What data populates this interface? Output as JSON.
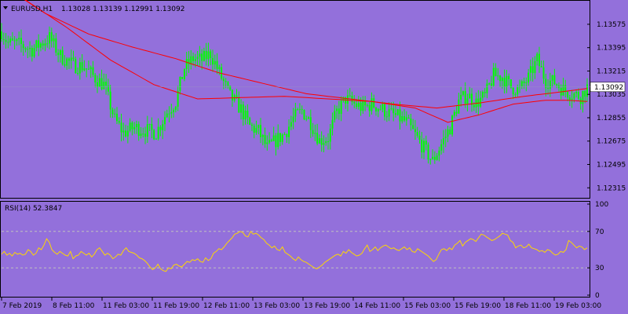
{
  "header": {
    "menu_arrow": "triangle-down-icon",
    "symbol": "EURUSD,H1",
    "ohlc": "1.13028 1.13139 1.12991 1.13092"
  },
  "rsi_header": "RSI(14) 52.3847",
  "colors": {
    "background": "#9370DB",
    "bull_candle": "#00FF00",
    "bear_candle": "#00FF00",
    "ma": "#FF0000",
    "rsi": "#FFD700",
    "rsi_levels": "#C0C0C0",
    "axis": "#000000"
  },
  "chart_data": [
    {
      "type": "candlestick",
      "title": "EURUSD,H1",
      "ylim": [
        1.1225,
        1.1375
      ],
      "y_ticks": [
        "1.13575",
        "1.13395",
        "1.13215",
        "1.13035",
        "1.12855",
        "1.12675",
        "1.12495",
        "1.12315"
      ],
      "current_price": "1.13092",
      "x_ticks": [
        "7 Feb 2019",
        "8 Feb 11:00",
        "11 Feb 03:00",
        "11 Feb 19:00",
        "12 Feb 11:00",
        "13 Feb 03:00",
        "13 Feb 19:00",
        "14 Feb 11:00",
        "15 Feb 03:00",
        "15 Feb 19:00",
        "18 Feb 11:00",
        "19 Feb 03:00"
      ],
      "close_path": [
        [
          0,
          1.1352
        ],
        [
          3,
          1.1343
        ],
        [
          8,
          1.1342
        ],
        [
          14,
          1.1338
        ],
        [
          22,
          1.1347
        ],
        [
          27,
          1.1333
        ],
        [
          33,
          1.1326
        ],
        [
          38,
          1.1325
        ],
        [
          43,
          1.1316
        ],
        [
          47,
          1.1311
        ],
        [
          52,
          1.1284
        ],
        [
          56,
          1.1274
        ],
        [
          61,
          1.1278
        ],
        [
          66,
          1.1276
        ],
        [
          71,
          1.1274
        ],
        [
          76,
          1.129
        ],
        [
          80,
          1.1298
        ],
        [
          84,
          1.1324
        ],
        [
          88,
          1.1331
        ],
        [
          92,
          1.133
        ],
        [
          96,
          1.1335
        ],
        [
          100,
          1.132
        ],
        [
          105,
          1.1302
        ],
        [
          110,
          1.1292
        ],
        [
          114,
          1.1279
        ],
        [
          118,
          1.1275
        ],
        [
          122,
          1.1262
        ],
        [
          126,
          1.1268
        ],
        [
          130,
          1.1273
        ],
        [
          134,
          1.1285
        ],
        [
          138,
          1.1291
        ],
        [
          142,
          1.1282
        ],
        [
          146,
          1.1268
        ],
        [
          150,
          1.127
        ],
        [
          154,
          1.129
        ],
        [
          158,
          1.13
        ],
        [
          162,
          1.1296
        ],
        [
          166,
          1.1293
        ],
        [
          170,
          1.1296
        ],
        [
          174,
          1.1293
        ],
        [
          178,
          1.1289
        ],
        [
          182,
          1.1286
        ],
        [
          186,
          1.1282
        ],
        [
          190,
          1.1272
        ],
        [
          194,
          1.1262
        ],
        [
          198,
          1.1252
        ],
        [
          202,
          1.1265
        ],
        [
          206,
          1.1278
        ],
        [
          210,
          1.1298
        ],
        [
          214,
          1.1303
        ],
        [
          218,
          1.1297
        ],
        [
          222,
          1.1302
        ],
        [
          226,
          1.1318
        ],
        [
          230,
          1.1317
        ],
        [
          234,
          1.1309
        ],
        [
          238,
          1.1307
        ],
        [
          242,
          1.1316
        ],
        [
          246,
          1.133
        ],
        [
          250,
          1.1314
        ],
        [
          254,
          1.1313
        ],
        [
          258,
          1.1307
        ],
        [
          262,
          1.1304
        ],
        [
          266,
          1.1302
        ],
        [
          269,
          1.1309
        ]
      ],
      "series": [
        {
          "name": "",
          "color": "#FF0000",
          "points": [
            [
              0,
              1.1388
            ],
            [
              20,
              1.1366
            ],
            [
              40,
              1.135
            ],
            [
              60,
              1.134
            ],
            [
              80,
              1.1331
            ],
            [
              100,
              1.132
            ],
            [
              120,
              1.1312
            ],
            [
              140,
              1.1304
            ],
            [
              160,
              1.13
            ],
            [
              180,
              1.1296
            ],
            [
              200,
              1.1293
            ],
            [
              220,
              1.1297
            ],
            [
              240,
              1.1302
            ],
            [
              255,
              1.1305
            ],
            [
              269,
              1.1308
            ]
          ]
        },
        {
          "name": "",
          "color": "#FF0000",
          "points": [
            [
              0,
              1.1395
            ],
            [
              12,
              1.1375
            ],
            [
              30,
              1.1355
            ],
            [
              50,
              1.133
            ],
            [
              70,
              1.1311
            ],
            [
              90,
              1.13
            ],
            [
              110,
              1.1301
            ],
            [
              130,
              1.1302
            ],
            [
              150,
              1.13
            ],
            [
              170,
              1.1298
            ],
            [
              190,
              1.1293
            ],
            [
              205,
              1.1282
            ],
            [
              220,
              1.1288
            ],
            [
              235,
              1.1296
            ],
            [
              250,
              1.1299
            ],
            [
              260,
              1.1299
            ],
            [
              269,
              1.1298
            ]
          ]
        }
      ]
    },
    {
      "type": "line",
      "title": "RSI(14) 52.3847",
      "ylim": [
        0,
        100
      ],
      "y_ticks": [
        "100",
        "70",
        "30",
        "0"
      ],
      "levels": [
        70,
        30
      ],
      "values": [
        45,
        48,
        44,
        46,
        43,
        47,
        45,
        46,
        44,
        45,
        50,
        48,
        44,
        46,
        52,
        50,
        55,
        62,
        58,
        50,
        47,
        45,
        48,
        46,
        44,
        43,
        48,
        40,
        43,
        44,
        48,
        46,
        44,
        46,
        42,
        45,
        50,
        52,
        48,
        44,
        46,
        44,
        40,
        42,
        45,
        44,
        49,
        52,
        48,
        47,
        46,
        44,
        41,
        40,
        38,
        35,
        31,
        28,
        30,
        34,
        29,
        27,
        26,
        30,
        29,
        33,
        34,
        32,
        31,
        34,
        37,
        36,
        39,
        38,
        40,
        37,
        36,
        41,
        38,
        40,
        46,
        48,
        51,
        50,
        53,
        57,
        60,
        63,
        67,
        68,
        70,
        69,
        65,
        64,
        70,
        67,
        68,
        66,
        63,
        61,
        57,
        55,
        52,
        54,
        50,
        49,
        53,
        47,
        45,
        43,
        40,
        38,
        42,
        39,
        37,
        36,
        34,
        32,
        30,
        29,
        31,
        33,
        36,
        38,
        40,
        42,
        44,
        45,
        43,
        48,
        46,
        50,
        47,
        45,
        43,
        44,
        46,
        51,
        55,
        48,
        50,
        53,
        49,
        52,
        54,
        55,
        53,
        51,
        52,
        50,
        49,
        51,
        53,
        50,
        52,
        48,
        47,
        51,
        49,
        47,
        45,
        43,
        40,
        37,
        39,
        45,
        50,
        51,
        49,
        52,
        50,
        55,
        57,
        60,
        54,
        58,
        60,
        62,
        61,
        59,
        63,
        67,
        66,
        64,
        62,
        60,
        61,
        63,
        65,
        68,
        67,
        66,
        60,
        58,
        52,
        54,
        55,
        52,
        53,
        56,
        52,
        51,
        50,
        48,
        49,
        47,
        50,
        49,
        46,
        44,
        45,
        48,
        47,
        50,
        60,
        58,
        55,
        52,
        54,
        53,
        50,
        52
      ],
      "values_count_note": ""
    }
  ]
}
